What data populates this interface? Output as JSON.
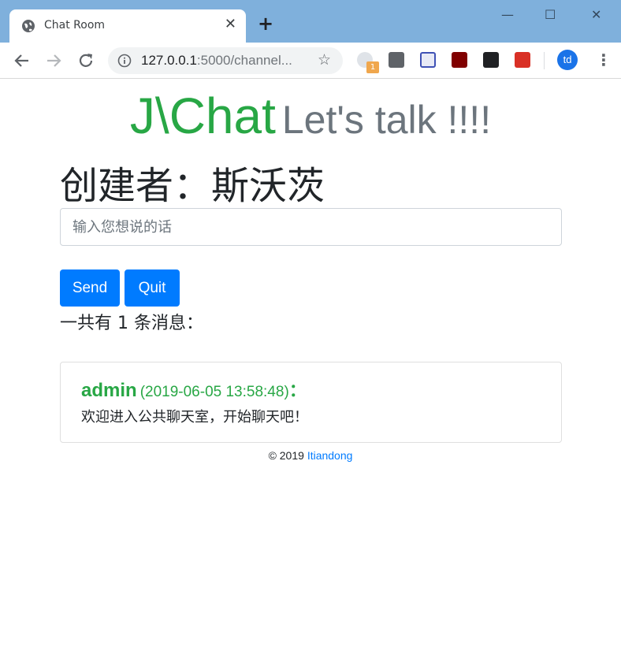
{
  "browser": {
    "tab_title": "Chat Room",
    "tab_close": "✕",
    "new_tab": "+",
    "url_host": "127.0.0.1",
    "url_rest": ":5000/channel...",
    "window_controls": {
      "minimize": "—",
      "maximize": "☐",
      "close": "✕"
    },
    "extension_badge": "1",
    "profile_initials": "td",
    "menu": "⋮",
    "star": "☆"
  },
  "page": {
    "brand_logo": "J\\Chat",
    "brand_tagline": "Let's talk !!!!",
    "creator": "创建者：斯沃茨",
    "input_placeholder": "输入您想说的话",
    "send_label": "Send",
    "quit_label": "Quit",
    "message_count": "一共有 1 条消息：",
    "messages": [
      {
        "user": "admin",
        "time": "(2019-06-05 13:58:48)",
        "colon": "：",
        "text": "欢迎进入公共聊天室，开始聊天吧！"
      }
    ],
    "footer_copyright": "© 2019 ",
    "footer_link": "Itiandong"
  },
  "colors": {
    "brand_green": "#28a745",
    "primary_blue": "#007bff",
    "titlebar": "#7fb0dc"
  }
}
